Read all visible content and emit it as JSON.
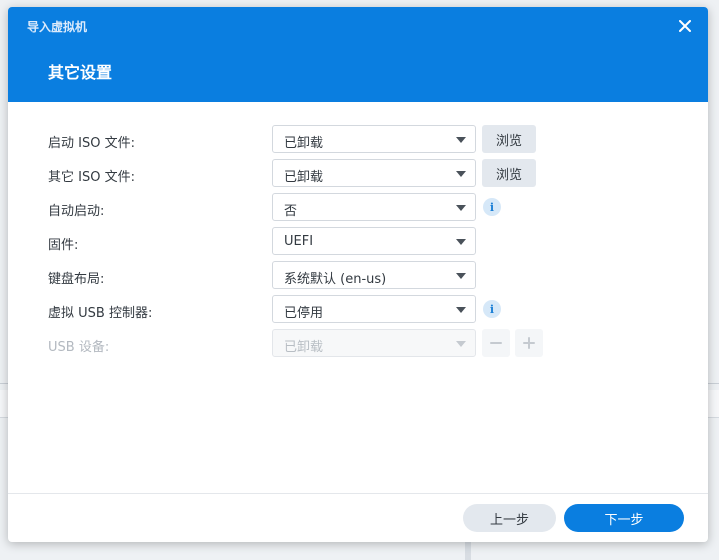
{
  "window": {
    "title": "导入虚拟机"
  },
  "page": {
    "title": "其它设置"
  },
  "colors": {
    "accent": "#0a7ee0",
    "button_secondary": "#e3e8ee"
  },
  "icons": {
    "close": "close-icon",
    "info": "info-icon",
    "caret": "chevron-down-icon",
    "minus": "minus-icon",
    "plus": "plus-icon"
  },
  "form": {
    "boot_iso": {
      "label": "启动 ISO 文件:",
      "value": "已卸载",
      "button": "浏览"
    },
    "other_iso": {
      "label": "其它 ISO 文件:",
      "value": "已卸载",
      "button": "浏览"
    },
    "autostart": {
      "label": "自动启动:",
      "value": "否",
      "info": "i"
    },
    "firmware": {
      "label": "固件:",
      "value": "UEFI"
    },
    "keyboard": {
      "label": "键盘布局:",
      "value": "系统默认 (en-us)"
    },
    "usb_controller": {
      "label": "虚拟 USB 控制器:",
      "value": "已停用",
      "info": "i"
    },
    "usb_device": {
      "label": "USB 设备:",
      "value": "已卸载"
    }
  },
  "footer": {
    "prev": "上一步",
    "next": "下一步"
  }
}
